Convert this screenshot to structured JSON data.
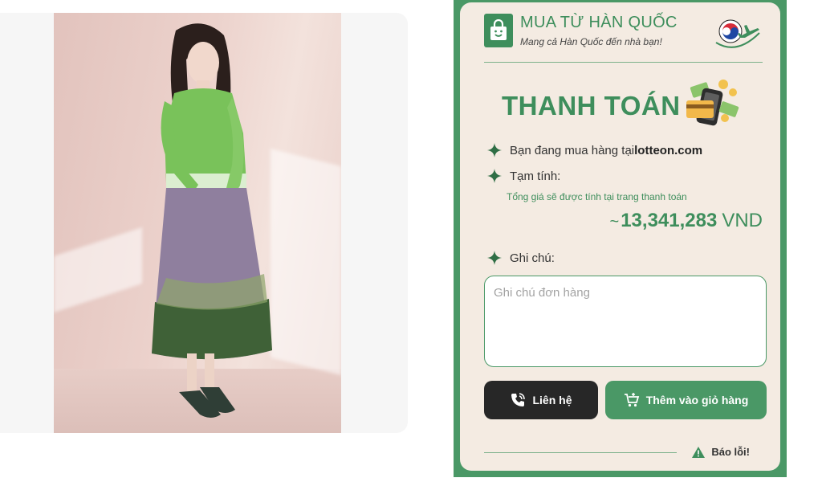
{
  "brand": {
    "title": "MUA TỪ HÀN QUỐC",
    "subtitle": "Mang cả Hàn Quốc đến nhà bạn!"
  },
  "checkout": {
    "heading": "THANH TOÁN",
    "store_prefix": "Bạn đang mua hàng tại ",
    "store_name": "lotteon.com",
    "subtotal_label": "Tạm tính:",
    "subtotal_note": "Tổng giá sẽ được tính tại trang thanh toán",
    "price_prefix": "~",
    "price_amount": "13,341,283",
    "price_currency": "VND",
    "note_label": "Ghi chú:",
    "note_placeholder": "Ghi chú đơn hàng",
    "note_value": ""
  },
  "actions": {
    "contact_label": "Liên hệ",
    "add_to_cart_label": "Thêm vào giỏ hàng",
    "report_label": "Báo lỗi!"
  },
  "icons": {
    "brand": "shopping-bag-icon",
    "flag": "korea-flag-plane-icon",
    "payment": "phone-card-payment-icon",
    "bullet": "sparkle-icon",
    "contact": "phone-icon",
    "cart": "cart-icon",
    "report": "warning-icon"
  },
  "colors": {
    "accent": "#4a9866",
    "card_bg": "#f4ebe2",
    "contact_bg": "#272727"
  }
}
